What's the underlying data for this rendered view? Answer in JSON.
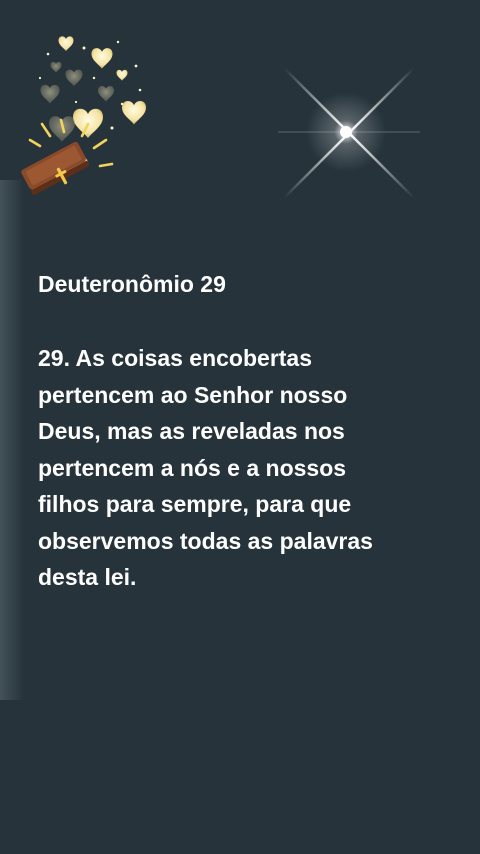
{
  "reading": {
    "title": "Deuteronômio 29",
    "verse": "29. As coisas encobertas\npertencem ao Senhor nosso\nDeus, mas as reveladas nos\npertencem a nós e a nossos\nfilhos para sempre, para que\nobservemos todas as palavras\ndesta lei."
  },
  "decorations": {
    "bible_icon": "bible-with-hearts-icon",
    "star_icon": "sparkle-star-icon"
  },
  "colors": {
    "background": "#26333b",
    "text": "#ffffff",
    "heart_glow": "#f4e3a1",
    "book_cover": "#8a4a2a",
    "cross": "#f2c84b"
  }
}
